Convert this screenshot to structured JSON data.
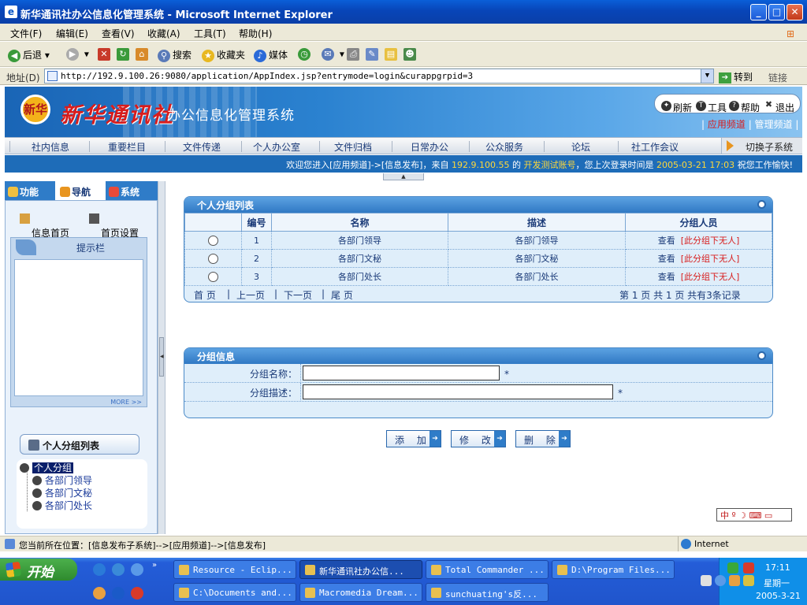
{
  "window": {
    "title": "新华通讯社办公信息化管理系统 - Microsoft Internet Explorer"
  },
  "menu": [
    "文件(F)",
    "编辑(E)",
    "查看(V)",
    "收藏(A)",
    "工具(T)",
    "帮助(H)"
  ],
  "toolbar": {
    "back": "后退",
    "search": "搜索",
    "favorites": "收藏夹",
    "media": "媒体"
  },
  "address": {
    "label": "地址(D)",
    "url": "http://192.9.100.26:9080/application/AppIndex.jsp?entrymode=login&curappgrpid=3",
    "go": "转到",
    "links": "链接"
  },
  "header": {
    "logo_seal": "新华",
    "logo_name": "新华通讯社",
    "system_name": "办公信息化管理系统",
    "tools": {
      "refresh": "刷新",
      "tools": "工具",
      "help": "帮助",
      "logout": "退出"
    },
    "channels": {
      "app": "应用频道",
      "manage": "管理频道"
    }
  },
  "nav": {
    "items": [
      "社内信息",
      "重要栏目",
      "文件传递",
      "个人办公室",
      "文件归档",
      "日常办公",
      "公众服务",
      "论坛",
      "社工作会议"
    ],
    "switch": "切换子系统"
  },
  "welcome": {
    "pre": "欢迎您进入[应用频道]->[信息发布]，来自",
    "ip": "192.9.100.55",
    "of": "的",
    "account": "开发测试账号",
    "mid": "，您上次登录时间是",
    "time": "2005-03-21 17:03",
    "post": "祝您工作愉快!"
  },
  "sidebar": {
    "tabs": [
      "功能",
      "导航",
      "系统"
    ],
    "links": [
      "信息首页",
      "首页设置"
    ],
    "tip_title": "提示栏",
    "more": "MORE >>",
    "group_button": "个人分组列表",
    "tree": {
      "root": "个人分组",
      "children": [
        "各部门领导",
        "各部门文秘",
        "各部门处长"
      ]
    }
  },
  "group_list": {
    "title": "个人分组列表",
    "columns": [
      "编号",
      "名称",
      "描述",
      "分组人员"
    ],
    "rows": [
      {
        "no": "1",
        "name": "各部门领导",
        "desc": "各部门领导",
        "view": "查看",
        "note": "[此分组下无人]"
      },
      {
        "no": "2",
        "name": "各部门文秘",
        "desc": "各部门文秘",
        "view": "查看",
        "note": "[此分组下无人]"
      },
      {
        "no": "3",
        "name": "各部门处长",
        "desc": "各部门处长",
        "view": "查看",
        "note": "[此分组下无人]"
      }
    ],
    "pager": {
      "first": "首 页",
      "prev": "上一页",
      "next": "下一页",
      "last": "尾 页",
      "sep": "|",
      "info": "第 1 页 共 1 页  共有3条记录"
    }
  },
  "group_info": {
    "title": "分组信息",
    "fields": [
      {
        "label": "分组名称：",
        "value": "",
        "required": "*"
      },
      {
        "label": "分组描述：",
        "value": "",
        "required": "*"
      }
    ]
  },
  "actions": {
    "add": "添 加",
    "edit": "修 改",
    "delete": "删 除"
  },
  "ime": "中 º ☽ ⌨ ▭",
  "status": {
    "location": "您当前所在位置：[信息发布子系统]-->[应用频道]-->[信息发布]",
    "zone": "Internet"
  },
  "taskbar": {
    "start": "开始",
    "tasks": [
      "Resource - Eclip...",
      "新华通讯社办公信...",
      "Total Commander ...",
      "D:\\Program Files...",
      "C:\\Documents and...",
      "Macromedia Dream...",
      "sunchuating's反..."
    ],
    "clock": "17:11",
    "weekday": "星期一",
    "date": "2005-3-21"
  },
  "colors": {
    "accent_blue": "#2f7cc8",
    "header_red": "#d81c1c",
    "highlight_yellow": "#ffd83a",
    "xp_title": "#0a56c6"
  }
}
